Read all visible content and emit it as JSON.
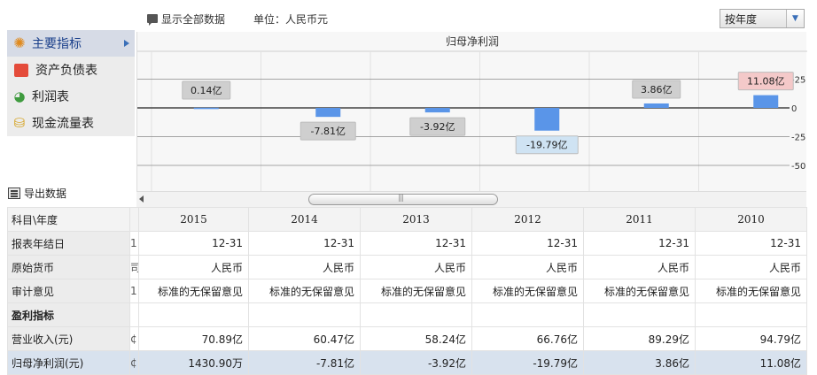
{
  "toolbar": {
    "show_all": "显示全部数据",
    "unit": "单位：人民币元",
    "period_select": "按年度"
  },
  "nav": {
    "items": [
      {
        "label": "主要指标",
        "icon": "star-icon",
        "active": true
      },
      {
        "label": "资产负债表",
        "icon": "document-icon",
        "active": false
      },
      {
        "label": "利润表",
        "icon": "pie-icon",
        "active": false
      },
      {
        "label": "现金流量表",
        "icon": "coins-icon",
        "active": false
      }
    ],
    "export": "导出数据"
  },
  "chart_data": {
    "type": "bar",
    "title": "归母净利润",
    "categories": [
      "2015",
      "2014",
      "2013",
      "2012",
      "2011",
      "2010"
    ],
    "values": [
      0.14,
      -7.81,
      -3.92,
      -19.79,
      3.86,
      11.08
    ],
    "data_labels": [
      "0.14亿",
      "-7.81亿",
      "-3.92亿",
      "-19.79亿",
      "3.86亿",
      "11.08亿"
    ],
    "yticks": [
      25,
      0,
      -25,
      -50
    ],
    "ylim": [
      -50,
      25
    ],
    "grid": true,
    "bar_color": "#5a95e8",
    "highlight_label_colors": {
      "max": "#f4c9c9",
      "min": "#cfe3f3"
    }
  },
  "table": {
    "corner": "科目\\年度",
    "years": [
      "2015",
      "2014",
      "2013",
      "2012",
      "2011",
      "2010"
    ],
    "rows": [
      {
        "label": "报表年结日",
        "stub": "1",
        "values": [
          "12-31",
          "12-31",
          "12-31",
          "12-31",
          "12-31",
          "12-31"
        ]
      },
      {
        "label": "原始货币",
        "stub": "司",
        "values": [
          "人民币",
          "人民币",
          "人民币",
          "人民币",
          "人民币",
          "人民币"
        ]
      },
      {
        "label": "审计意见",
        "stub": "1",
        "values": [
          "标准的无保留意见",
          "标准的无保留意见",
          "标准的无保留意见",
          "标准的无保留意见",
          "标准的无保留意见",
          "标准的无保留意见"
        ]
      },
      {
        "label": "盈利指标",
        "stub": "",
        "section": true,
        "values": [
          "",
          "",
          "",
          "",
          "",
          ""
        ]
      },
      {
        "label": "营业收入(元)",
        "stub": "¢",
        "values": [
          "70.89亿",
          "60.47亿",
          "58.24亿",
          "66.76亿",
          "89.29亿",
          "94.79亿"
        ]
      },
      {
        "label": "归母净利润(元)",
        "stub": "¢",
        "highlight": true,
        "values": [
          "1430.90万",
          "-7.81亿",
          "-3.92亿",
          "-19.79亿",
          "3.86亿",
          "11.08亿"
        ]
      }
    ]
  }
}
